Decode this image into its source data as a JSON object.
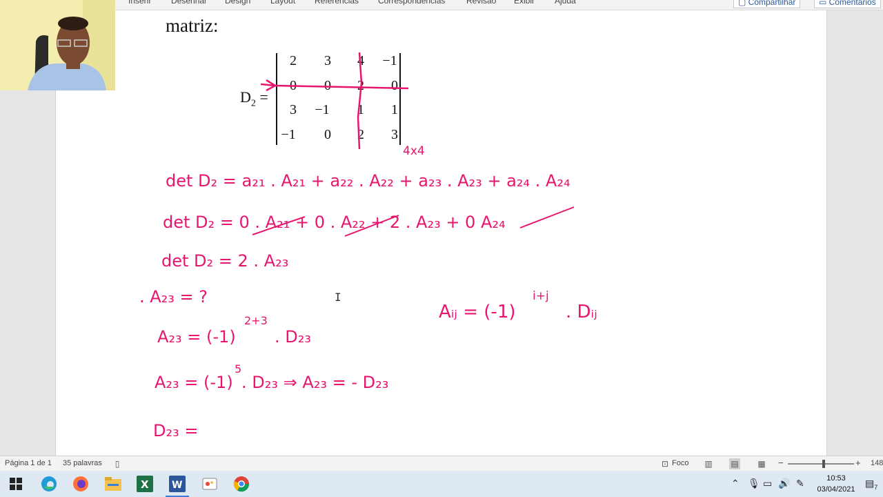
{
  "ribbon": {
    "menus": [
      "Inserir",
      "Desenhar",
      "Design",
      "Layout",
      "Referências",
      "Correspondências",
      "Revisão",
      "Exibir",
      "Ajuda"
    ],
    "share_label": "Compartilhar",
    "comments_label": "Comentários"
  },
  "document": {
    "heading_fragment": "matriz:",
    "matrix_name": "D",
    "matrix_subscript": "2",
    "matrix_rows": [
      [
        "2",
        "3",
        "4",
        "−1"
      ],
      [
        "0",
        "0",
        "2",
        "0"
      ],
      [
        "3",
        "−1",
        "1",
        "1"
      ],
      [
        "−1",
        "0",
        "2",
        "3"
      ]
    ]
  },
  "handwriting": {
    "size_note": "4x4",
    "line1": "det D₂ = a₂₁ . A₂₁ + a₂₂ . A₂₂ + a₂₃ . A₂₃ + a₂₄ . A₂₄",
    "line2": "det D₂ = 0 . A₂₁ + 0 . A₂₂ + 2 . A₂₃ + 0 A₂₄",
    "line3": "det D₂ = 2 . A₂₃",
    "line4": ". A₂₃ = ?",
    "formula": "Aᵢⱼ = (-1)",
    "formula_exp": "i+j",
    "formula_tail": ". Dᵢⱼ",
    "line5": "A₂₃ = (-1)",
    "line5_exp": "2+3",
    "line5_tail": ". D₂₃",
    "line6": "A₂₃ = (-1)",
    "line6_exp": "5",
    "line6_tail": ". D₂₃ ⇒ A₂₃ = - D₂₃",
    "line7": "D₂₃ ="
  },
  "statusbar": {
    "page_info": "Página 1 de 1",
    "word_count": "35 palavras",
    "focus_label": "Foco",
    "zoom_minus": "−",
    "zoom_plus": "+",
    "zoom_level": "148"
  },
  "taskbar": {
    "time": "10:53",
    "date": "03/04/2021",
    "notification_count": "7"
  },
  "colors": {
    "ink": "#e8156e",
    "taskbar": "#dfe9f3"
  }
}
